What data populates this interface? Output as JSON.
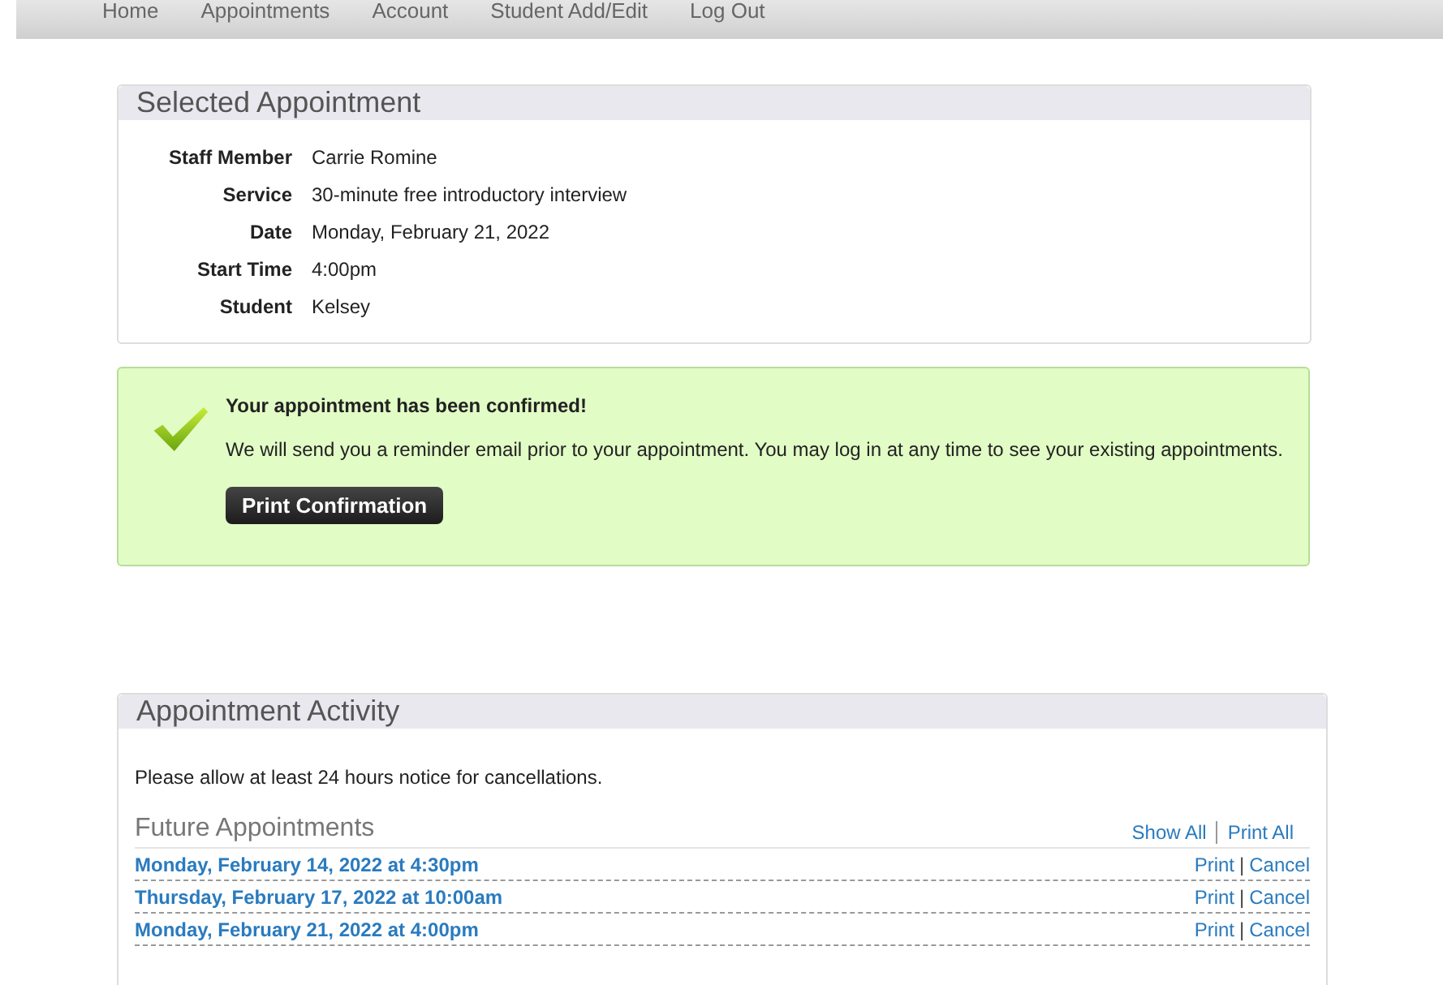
{
  "nav": [
    {
      "label": "Home"
    },
    {
      "label": "Appointments"
    },
    {
      "label": "Account"
    },
    {
      "label": "Student Add/Edit"
    },
    {
      "label": "Log Out"
    }
  ],
  "selected_appointment": {
    "title": "Selected Appointment",
    "fields": [
      {
        "label": "Staff Member",
        "value": "Carrie Romine"
      },
      {
        "label": "Service",
        "value": "30-minute free introductory interview"
      },
      {
        "label": "Date",
        "value": "Monday, February 21, 2022"
      },
      {
        "label": "Start Time",
        "value": "4:00pm"
      },
      {
        "label": "Student",
        "value": "Kelsey"
      }
    ]
  },
  "confirmation": {
    "heading": "Your appointment has been confirmed!",
    "message": "We will send you a reminder email prior to your appointment. You may log in at any time to see your existing appointments.",
    "button": "Print Confirmation"
  },
  "activity": {
    "title": "Appointment Activity",
    "notice": "Please allow at least 24 hours notice for cancellations.",
    "section_title": "Future Appointments",
    "links": [
      "Show All",
      "Print All"
    ],
    "appointments": [
      {
        "when": "Monday, February 14, 2022 at 4:30pm",
        "print": "Print",
        "separator": "|",
        "cancel": "Cancel"
      },
      {
        "when": "Thursday, February 17, 2022 at 10:00am",
        "print": "Print",
        "separator": "|",
        "cancel": "Cancel"
      },
      {
        "when": "Monday, February 21, 2022 at 4:00pm",
        "print": "Print",
        "separator": "|",
        "cancel": "Cancel"
      }
    ]
  }
}
